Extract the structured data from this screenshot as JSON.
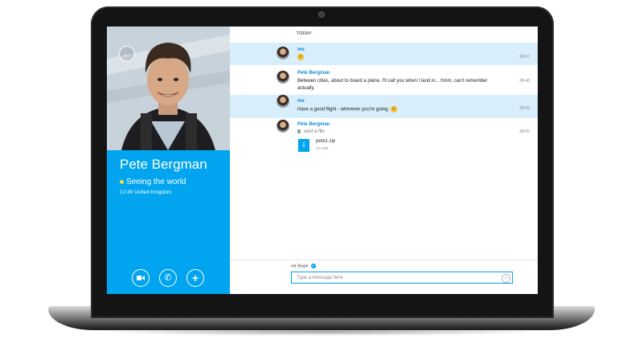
{
  "contact": {
    "name": "Pete Bergman",
    "status": "Seeing the world",
    "local_time": "12:45 United Kingdom"
  },
  "chat": {
    "day_label": "TODAY",
    "messages": [
      {
        "sender": "me",
        "text": "",
        "emoji": "☺",
        "time": "08:47"
      },
      {
        "sender": "Pete Bergman",
        "text": "Between cities, about to board a plane, I'll call you when I land in... hmm, can't remember actually.",
        "time": "08:48"
      },
      {
        "sender": "me",
        "text": "Have a good flight - wherever you're going.",
        "emoji": "☺",
        "time": "08:49"
      },
      {
        "sender": "Pete Bergman",
        "text": "sent a file",
        "time": "08:50",
        "file_name": "pete1.zip",
        "file_size": "22.5MB"
      }
    ]
  },
  "composer": {
    "via_label": "via Skype",
    "placeholder": "Type a message here"
  },
  "colors": {
    "accent": "#00a4ef",
    "highlight": "#d8eefb"
  }
}
